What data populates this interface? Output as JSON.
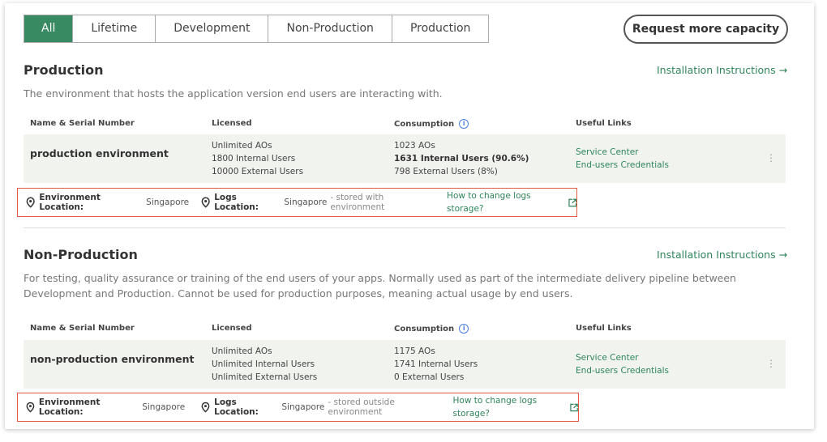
{
  "tabs": [
    {
      "label": "All",
      "active": true
    },
    {
      "label": "Lifetime"
    },
    {
      "label": "Development"
    },
    {
      "label": "Non-Production"
    },
    {
      "label": "Production"
    }
  ],
  "request_button": "Request more capacity",
  "columns": {
    "name": "Name & Serial Number",
    "licensed": "Licensed",
    "consumption": "Consumption",
    "links": "Useful Links"
  },
  "sections": [
    {
      "title": "Production",
      "installation": "Installation Instructions →",
      "description": "The environment that hosts the application version end users are interacting with.",
      "env_name": "production environment",
      "licensed": [
        "Unlimited AOs",
        "1800 Internal Users",
        "10000 External Users"
      ],
      "consumption": [
        "1023 AOs",
        "1631 Internal Users (90.6%)",
        "798 External Users (8%)"
      ],
      "links": [
        "Service Center",
        "End-users Credentials"
      ],
      "env_location_label": "Environment Location:",
      "env_location": "Singapore",
      "logs_location_label": "Logs Location:",
      "logs_location": "Singapore",
      "logs_note": "- stored with environment",
      "logs_link": "How to change logs storage?"
    },
    {
      "title": "Non-Production",
      "installation": "Installation Instructions →",
      "description": "For testing, quality assurance or training of the end users of your apps. Normally used as part of the intermediate delivery pipeline between Development and Production. Cannot be used for production purposes, meaning actual usage by end users.",
      "env_name": "non-production environment",
      "licensed": [
        "Unlimited AOs",
        "Unlimited Internal Users",
        "Unlimited External Users"
      ],
      "consumption": [
        "1175 AOs",
        "1741 Internal Users",
        "0 External Users"
      ],
      "links": [
        "Service Center",
        "End-users Credentials"
      ],
      "env_location_label": "Environment Location:",
      "env_location": "Singapore",
      "logs_location_label": "Logs Location:",
      "logs_location": "Singapore",
      "logs_note": "- stored outside environment",
      "logs_link": "How to change logs storage?"
    }
  ]
}
